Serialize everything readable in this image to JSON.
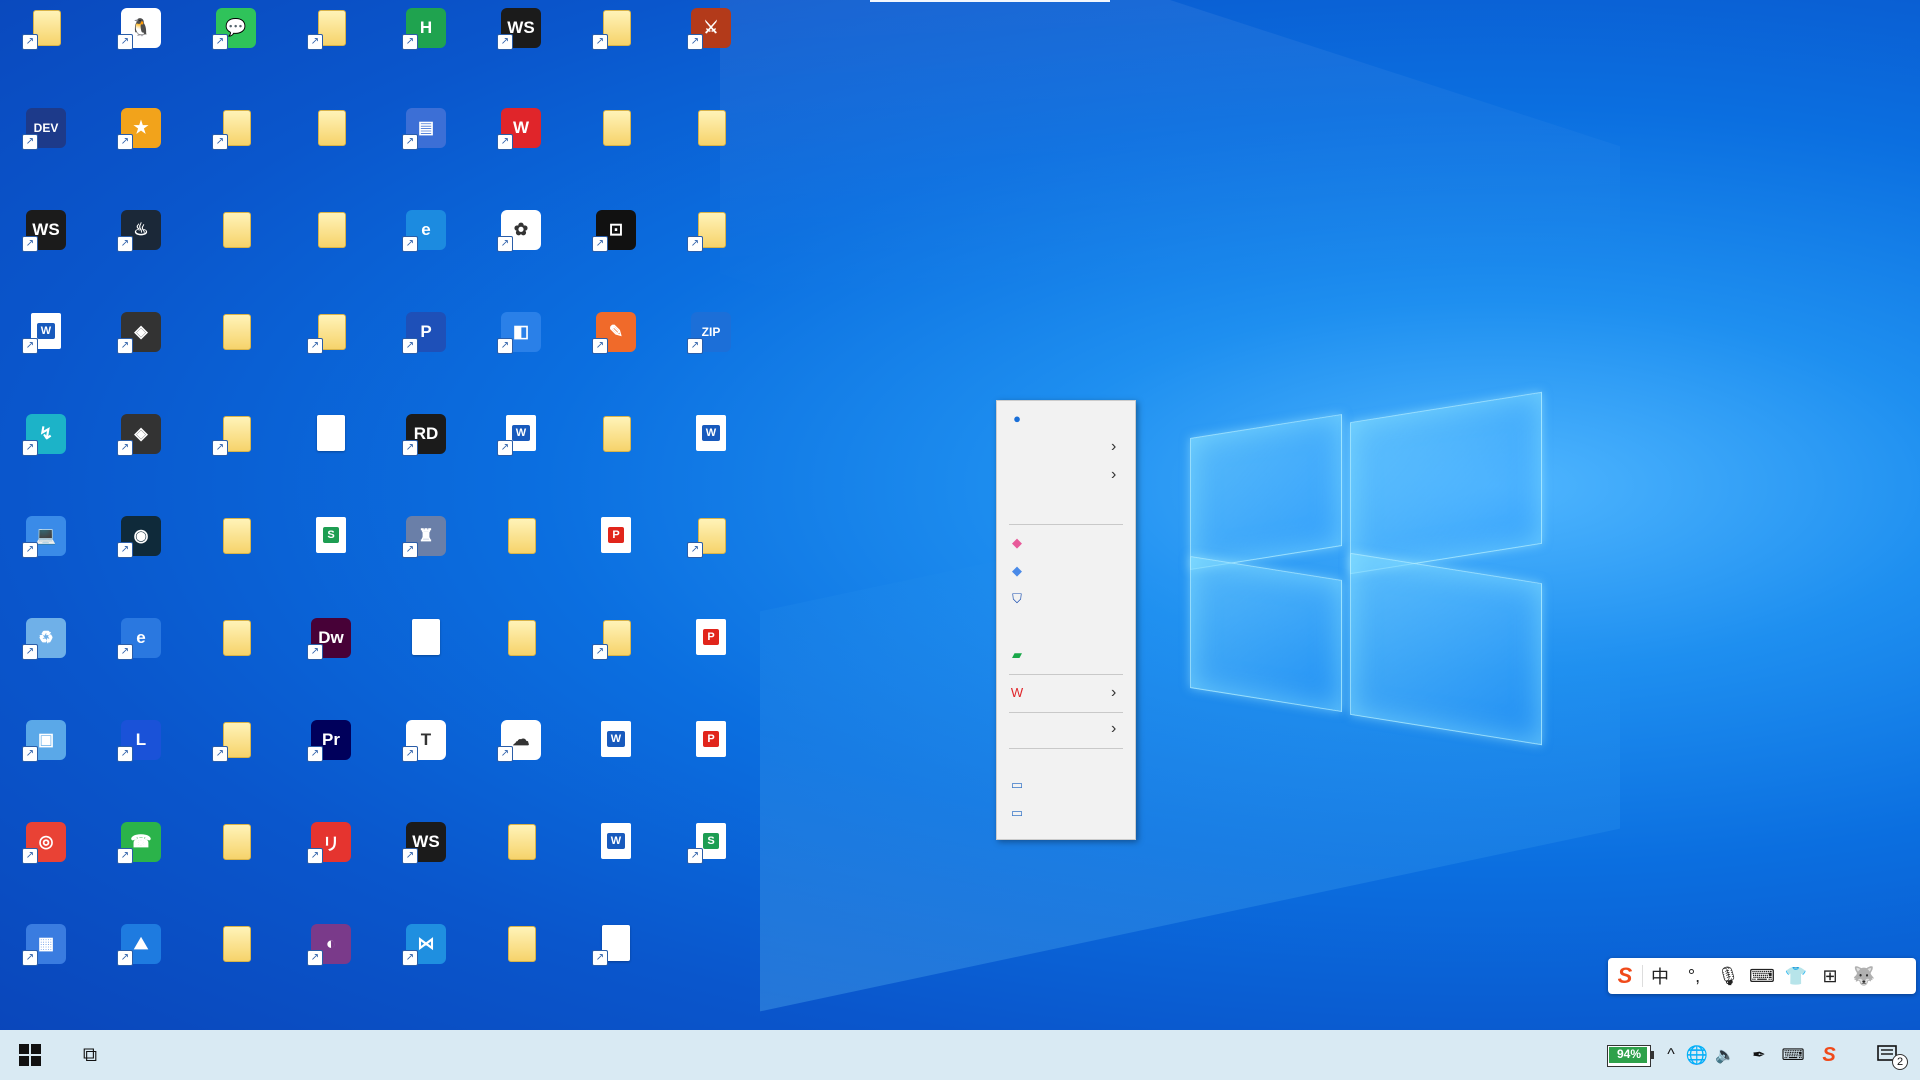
{
  "desktop": {
    "icons": [
      {
        "id": "r1c1",
        "kind": "folder"
      },
      {
        "id": "r1c2",
        "kind": "app",
        "text": "🐧",
        "color": "#ffffff"
      },
      {
        "id": "r1c3",
        "kind": "app",
        "text": "💬",
        "color": "#2fc35a"
      },
      {
        "id": "r1c4",
        "kind": "folder"
      },
      {
        "id": "r1c5",
        "kind": "app",
        "text": "H",
        "color": "#1fa34f"
      },
      {
        "id": "r1c6",
        "kind": "app",
        "text": "WS",
        "color": "#1b1b1b"
      },
      {
        "id": "r1c7",
        "kind": "folder"
      },
      {
        "id": "r1c8",
        "kind": "app",
        "text": "⚔",
        "color": "#b33a1a"
      },
      {
        "id": "r2c1",
        "kind": "app",
        "text": "DEV",
        "color": "#1d3a8a"
      },
      {
        "id": "r2c2",
        "kind": "app",
        "text": "★",
        "color": "#f2a31b"
      },
      {
        "id": "r2c3",
        "kind": "folder"
      },
      {
        "id": "r2c4",
        "kind": "folder"
      },
      {
        "id": "r2c5",
        "kind": "app",
        "text": "▤",
        "color": "#3c6fd6"
      },
      {
        "id": "r2c6",
        "kind": "app",
        "text": "W",
        "color": "#e0252a"
      },
      {
        "id": "r2c7",
        "kind": "folder"
      },
      {
        "id": "r2c8",
        "kind": "folder"
      },
      {
        "id": "r3c1",
        "kind": "app",
        "text": "WS",
        "color": "#1b1b1b"
      },
      {
        "id": "r3c2",
        "kind": "app",
        "text": "♨",
        "color": "#1b2838"
      },
      {
        "id": "r3c3",
        "kind": "folder"
      },
      {
        "id": "r3c4",
        "kind": "folder"
      },
      {
        "id": "r3c5",
        "kind": "app",
        "text": "e",
        "color": "#1c8be0"
      },
      {
        "id": "r3c6",
        "kind": "app",
        "text": "✿",
        "color": "#ffffff"
      },
      {
        "id": "r3c7",
        "kind": "app",
        "text": "⊡",
        "color": "#111111"
      },
      {
        "id": "r3c8",
        "kind": "folder"
      },
      {
        "id": "r4c1",
        "kind": "word",
        "text": "W"
      },
      {
        "id": "r4c2",
        "kind": "app",
        "text": "◈",
        "color": "#333333"
      },
      {
        "id": "r4c3",
        "kind": "folder"
      },
      {
        "id": "r4c4",
        "kind": "folder"
      },
      {
        "id": "r4c5",
        "kind": "app",
        "text": "P",
        "color": "#1e50b8"
      },
      {
        "id": "r4c6",
        "kind": "app",
        "text": "◧",
        "color": "#2a80e8"
      },
      {
        "id": "r4c7",
        "kind": "app",
        "text": "✎",
        "color": "#f06a2a"
      },
      {
        "id": "r4c8",
        "kind": "app",
        "text": "ZIP",
        "color": "#1c6fd8"
      },
      {
        "id": "r5c1",
        "kind": "app",
        "text": "↯",
        "color": "#1cb3c8"
      },
      {
        "id": "r5c2",
        "kind": "app",
        "text": "◈",
        "color": "#333333"
      },
      {
        "id": "r5c3",
        "kind": "folder"
      },
      {
        "id": "r5c4",
        "kind": "doc",
        "text": ""
      },
      {
        "id": "r5c5",
        "kind": "app",
        "text": "RD",
        "color": "#1b1b1b"
      },
      {
        "id": "r5c6",
        "kind": "word",
        "text": "W"
      },
      {
        "id": "r5c7",
        "kind": "folder"
      },
      {
        "id": "r5c8",
        "kind": "word",
        "text": "W"
      },
      {
        "id": "r6c1",
        "kind": "app",
        "text": "💻",
        "color": "#3a8be8"
      },
      {
        "id": "r6c2",
        "kind": "app",
        "text": "◉",
        "color": "#0f2a3a"
      },
      {
        "id": "r6c3",
        "kind": "folder"
      },
      {
        "id": "r6c4",
        "kind": "xls",
        "text": "S"
      },
      {
        "id": "r6c5",
        "kind": "app",
        "text": "♜",
        "color": "#6a7fa8"
      },
      {
        "id": "r6c6",
        "kind": "folder"
      },
      {
        "id": "r6c7",
        "kind": "pdf",
        "text": "P"
      },
      {
        "id": "r6c8",
        "kind": "folder"
      },
      {
        "id": "r7c1",
        "kind": "app",
        "text": "♻",
        "color": "#6fb0e8"
      },
      {
        "id": "r7c2",
        "kind": "app",
        "text": "e",
        "color": "#2a78e0"
      },
      {
        "id": "r7c3",
        "kind": "folder"
      },
      {
        "id": "r7c4",
        "kind": "app",
        "text": "Dw",
        "color": "#470137"
      },
      {
        "id": "r7c5",
        "kind": "doc",
        "text": ""
      },
      {
        "id": "r7c6",
        "kind": "folder"
      },
      {
        "id": "r7c7",
        "kind": "folder"
      },
      {
        "id": "r7c8",
        "kind": "pdf",
        "text": "P"
      },
      {
        "id": "r8c1",
        "kind": "app",
        "text": "▣",
        "color": "#5aa8e8"
      },
      {
        "id": "r8c2",
        "kind": "app",
        "text": "L",
        "color": "#1a52d8"
      },
      {
        "id": "r8c3",
        "kind": "folder"
      },
      {
        "id": "r8c4",
        "kind": "app",
        "text": "Pr",
        "color": "#00005b"
      },
      {
        "id": "r8c5",
        "kind": "app",
        "text": "T",
        "color": "#ffffff"
      },
      {
        "id": "r8c6",
        "kind": "app",
        "text": "☁",
        "color": "#ffffff"
      },
      {
        "id": "r8c7",
        "kind": "word",
        "text": "W"
      },
      {
        "id": "r8c8",
        "kind": "pdf",
        "text": "P"
      },
      {
        "id": "r9c1",
        "kind": "app",
        "text": "◎",
        "color": "#e94235"
      },
      {
        "id": "r9c2",
        "kind": "app",
        "text": "☎",
        "color": "#2bb34a"
      },
      {
        "id": "r9c3",
        "kind": "folder"
      },
      {
        "id": "r9c4",
        "kind": "app",
        "text": "リ",
        "color": "#e5342f"
      },
      {
        "id": "r9c5",
        "kind": "app",
        "text": "WS",
        "color": "#1b1b1b"
      },
      {
        "id": "r9c6",
        "kind": "folder"
      },
      {
        "id": "r9c7",
        "kind": "word",
        "text": "W"
      },
      {
        "id": "r9c8",
        "kind": "xls",
        "text": "S"
      },
      {
        "id": "r10c1",
        "kind": "app",
        "text": "▦",
        "color": "#3a7ce0"
      },
      {
        "id": "r10c2",
        "kind": "app",
        "text": "⛰",
        "color": "#1e7be0"
      },
      {
        "id": "r10c3",
        "kind": "folder"
      },
      {
        "id": "r10c4",
        "kind": "app",
        "text": "◐",
        "color": "#7a3a8a"
      },
      {
        "id": "r10c5",
        "kind": "app",
        "text": "⋈",
        "color": "#1f8fe0"
      },
      {
        "id": "r10c6",
        "kind": "folder"
      },
      {
        "id": "r10c7",
        "kind": "doc",
        "text": ""
      }
    ]
  },
  "context_menu": {
    "items": [
      {
        "icon": "●",
        "icon_color": "#1a6fd8",
        "arrow": false
      },
      {
        "icon": "",
        "arrow": true
      },
      {
        "icon": "",
        "arrow": true
      },
      {
        "icon": "",
        "arrow": false
      },
      {
        "sep": true
      },
      {
        "icon": "◆",
        "icon_color": "#e85a9a",
        "arrow": false
      },
      {
        "icon": "◆",
        "icon_color": "#4a8ae8",
        "arrow": false
      },
      {
        "icon": "⛉",
        "icon_color": "#1a4fb0",
        "arrow": false
      },
      {
        "icon": "",
        "arrow": false
      },
      {
        "icon": "▰",
        "icon_color": "#1aa84a",
        "arrow": false
      },
      {
        "sep": true
      },
      {
        "icon": "W",
        "icon_color": "#e0252a",
        "arrow": true
      },
      {
        "sep": true
      },
      {
        "icon": "",
        "arrow": true
      },
      {
        "sep": true
      },
      {
        "icon": "▭",
        "icon_color": "#3a78c8",
        "arrow": false
      },
      {
        "icon": "▭",
        "icon_color": "#3a78c8",
        "arrow": false
      }
    ]
  },
  "ime_bar": {
    "logo": "S",
    "items": [
      "中",
      "°,",
      "🎙",
      "⌨",
      "👕",
      "⊞",
      "🐺"
    ]
  },
  "taskbar": {
    "start_icon": "⊞",
    "taskview_icon": "⧉",
    "battery_text": "94%",
    "battery_level": 0.94,
    "tray_icons": [
      "^",
      "🌐",
      "🔈",
      "✒",
      "⌨",
      "S"
    ],
    "notification_count": "2"
  }
}
